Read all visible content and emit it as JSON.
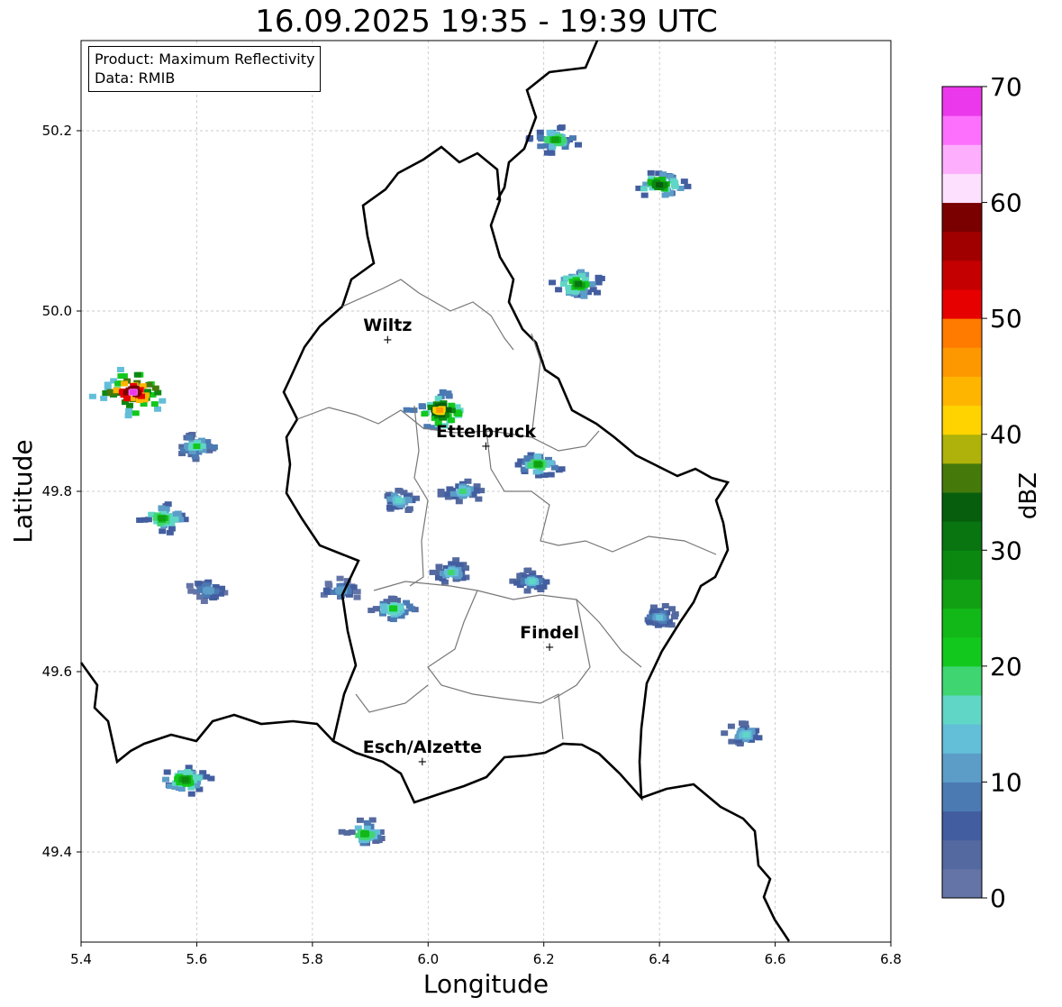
{
  "title": "16.09.2025 19:35 - 19:39 UTC",
  "info_box": {
    "product": "Product: Maximum Reflectivity",
    "data": "Data: RMIB"
  },
  "axes": {
    "xlabel": "Longitude",
    "ylabel": "Latitude",
    "xlim": [
      5.4,
      6.8
    ],
    "ylim": [
      49.3,
      50.3
    ],
    "xticks": [
      5.4,
      5.6,
      5.8,
      6.0,
      6.2,
      6.4,
      6.6,
      6.8
    ],
    "xtick_labels": [
      "5.4",
      "5.6",
      "5.8",
      "6.0",
      "6.2",
      "6.4",
      "6.6",
      "6.8"
    ],
    "yticks": [
      49.4,
      49.6,
      49.8,
      50.0,
      50.2
    ],
    "ytick_labels": [
      "49.4",
      "49.6",
      "49.8",
      "50.0",
      "50.2"
    ],
    "grid": true
  },
  "cities": [
    {
      "name": "Wiltz",
      "lon": 5.93,
      "lat": 49.968
    },
    {
      "name": "Ettelbruck",
      "lon": 6.1,
      "lat": 49.85
    },
    {
      "name": "Findel",
      "lon": 6.21,
      "lat": 49.627
    },
    {
      "name": "Esch/Alzette",
      "lon": 5.99,
      "lat": 49.5
    }
  ],
  "colorbar": {
    "label": "dBZ",
    "min": 0,
    "max": 70,
    "step": 2.5,
    "tick_values": [
      0,
      10,
      20,
      30,
      40,
      50,
      60,
      70
    ],
    "tick_labels": [
      "0",
      "10",
      "20",
      "30",
      "40",
      "50",
      "60",
      "70"
    ],
    "colors": [
      "#6474a6",
      "#53699f",
      "#435ea0",
      "#4b7ab3",
      "#5c9dc8",
      "#63bed8",
      "#5fd6c6",
      "#3fd672",
      "#12c81c",
      "#12b817",
      "#119f14",
      "#0b8810",
      "#087510",
      "#075f0d",
      "#457a0b",
      "#aeb20a",
      "#fed300",
      "#feb500",
      "#fe9800",
      "#fe7b00",
      "#e60000",
      "#c50000",
      "#a10000",
      "#7a0000",
      "#fde0fd",
      "#fdaefd",
      "#fd70fd",
      "#ec38ec"
    ]
  },
  "echoes": [
    {
      "lon": 6.19,
      "lat": 49.83,
      "dbz": 25
    },
    {
      "lon": 6.06,
      "lat": 49.8,
      "dbz": 18
    },
    {
      "lon": 5.95,
      "lat": 49.79,
      "dbz": 16
    },
    {
      "lon": 5.94,
      "lat": 49.67,
      "dbz": 22
    },
    {
      "lon": 6.04,
      "lat": 49.71,
      "dbz": 18
    },
    {
      "lon": 6.18,
      "lat": 49.7,
      "dbz": 15
    },
    {
      "lon": 5.85,
      "lat": 49.69,
      "dbz": 12
    },
    {
      "lon": 6.4,
      "lat": 49.66,
      "dbz": 14
    },
    {
      "lon": 5.54,
      "lat": 49.77,
      "dbz": 27
    },
    {
      "lon": 5.6,
      "lat": 49.85,
      "dbz": 20
    },
    {
      "lon": 5.49,
      "lat": 49.91,
      "dbz": 68
    },
    {
      "lon": 6.26,
      "lat": 50.03,
      "dbz": 30
    },
    {
      "lon": 6.02,
      "lat": 49.89,
      "dbz": 45
    },
    {
      "lon": 6.4,
      "lat": 50.14,
      "dbz": 33
    },
    {
      "lon": 6.22,
      "lat": 50.19,
      "dbz": 26
    },
    {
      "lon": 5.58,
      "lat": 49.48,
      "dbz": 28
    },
    {
      "lon": 5.89,
      "lat": 49.42,
      "dbz": 24
    },
    {
      "lon": 6.55,
      "lat": 49.53,
      "dbz": 16
    },
    {
      "lon": 5.62,
      "lat": 49.69,
      "dbz": 12
    }
  ]
}
